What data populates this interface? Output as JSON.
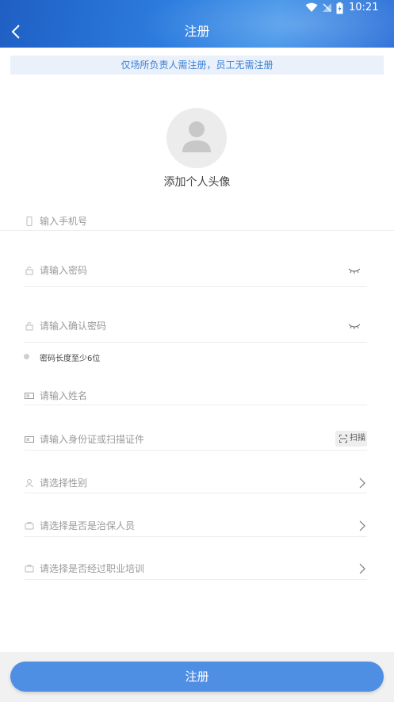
{
  "status_bar": {
    "time": "10:21"
  },
  "header": {
    "title": "注册"
  },
  "notice": "仅场所负责人需注册，员工无需注册",
  "avatar": {
    "label": "添加个人头像"
  },
  "form": {
    "phone_placeholder": "输入手机号",
    "password_placeholder": "请输入密码",
    "confirm_password_placeholder": "请输入确认密码",
    "password_hint": "密码长度至少6位",
    "name_placeholder": "请输入姓名",
    "id_placeholder": "请输入身份证或扫描证件",
    "scan_label": "扫描",
    "gender_placeholder": "请选择性别",
    "security_placeholder": "请选择是否是治保人员",
    "training_placeholder": "请选择是否经过职业培训"
  },
  "submit_label": "注册",
  "colors": {
    "primary": "#4f8fe3",
    "header": "#2d7ee0",
    "notice_bg": "#eaf1fb",
    "notice_text": "#3a7fd6"
  }
}
